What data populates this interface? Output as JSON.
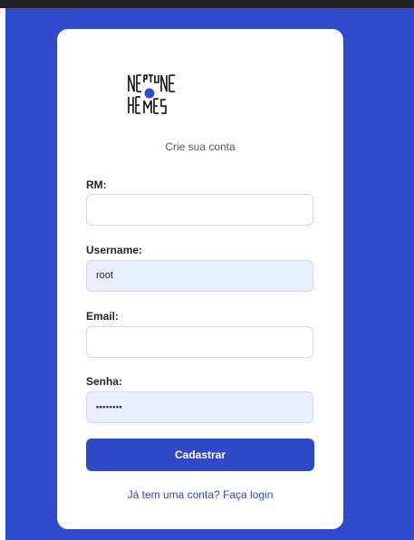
{
  "logo": {
    "line1": "NEPTUNE",
    "line2": "HOMES"
  },
  "form": {
    "subtitle": "Crie sua conta",
    "fields": {
      "rm": {
        "label": "RM:",
        "value": ""
      },
      "username": {
        "label": "Username:",
        "value": "root"
      },
      "email": {
        "label": "Email:",
        "value": ""
      },
      "password": {
        "label": "Senha:",
        "value": "••••••••"
      }
    },
    "submit_label": "Cadastrar",
    "login_link": "Já tem uma conta? Faça login"
  },
  "colors": {
    "background": "#2f4bcc",
    "accent": "#3049c8",
    "filled_field": "#e8effd"
  }
}
